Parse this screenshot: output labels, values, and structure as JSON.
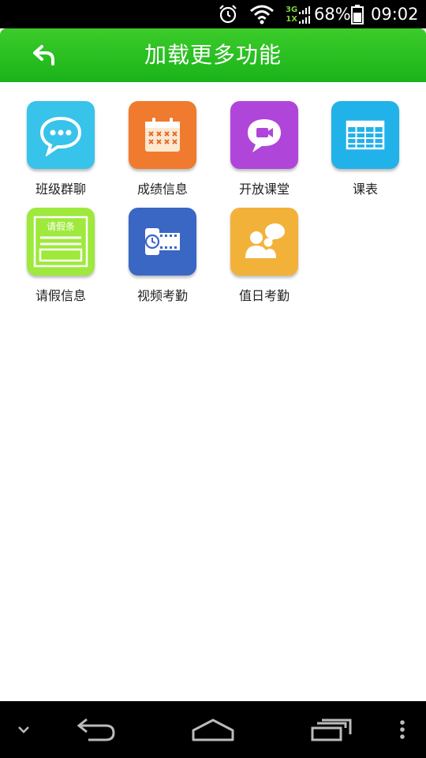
{
  "status_bar": {
    "battery_percent": "68%",
    "time": "09:02",
    "network_top": "3G",
    "network_bottom": "1X",
    "icons": [
      "alarm-icon",
      "wifi-icon",
      "signal-icon",
      "battery-icon"
    ]
  },
  "header": {
    "title": "加载更多功能",
    "back_icon": "back-arrow-icon",
    "color": "#2db82a"
  },
  "features": [
    {
      "label": "班级群聊",
      "icon": "chat-bubble-icon",
      "color": "#38c3ea"
    },
    {
      "label": "成绩信息",
      "icon": "calendar-icon",
      "color": "#f07a2e"
    },
    {
      "label": "开放课堂",
      "icon": "video-chat-icon",
      "color": "#b046d9"
    },
    {
      "label": "课表",
      "icon": "timetable-icon",
      "color": "#22b2ea"
    },
    {
      "label": "请假信息",
      "icon": "leave-note-icon",
      "color": "#9ee93c",
      "icon_text": "请假条"
    },
    {
      "label": "视频考勤",
      "icon": "film-clock-icon",
      "color": "#3a66c4"
    },
    {
      "label": "值日考勤",
      "icon": "people-speech-icon",
      "color": "#f2b23a"
    }
  ],
  "nav_bar": {
    "icons": [
      "collapse-icon",
      "back-icon",
      "home-icon",
      "recent-apps-icon",
      "menu-icon"
    ]
  }
}
